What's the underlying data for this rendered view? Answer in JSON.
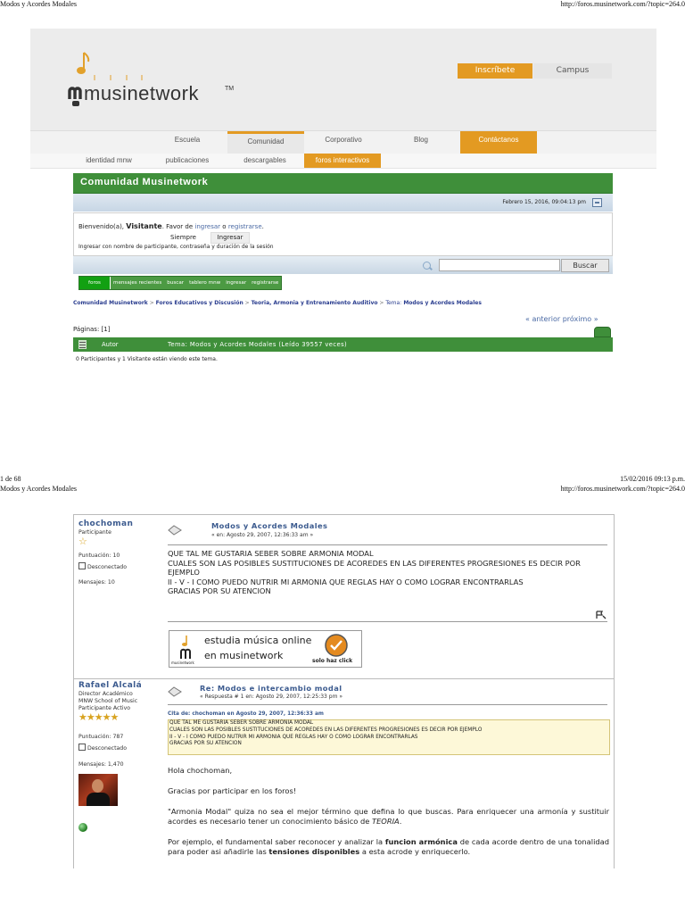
{
  "print": {
    "title": "Modos y Acordes Modales",
    "url": "http://foros.musinetwork.com/?topic=264.0",
    "page_no": "1 de 68",
    "datetime": "15/02/2016 09:13 p.m."
  },
  "header": {
    "logo": "musinetwork",
    "tm": "TM",
    "btn_inscribete": "Inscríbete",
    "btn_campus": "Campus",
    "nav1": [
      "Escuela",
      "Comunidad",
      "Corporativo",
      "Blog",
      "Contáctanos"
    ],
    "nav2": [
      "identidad mnw",
      "publicaciones",
      "descargables",
      "foros interactivos"
    ]
  },
  "forum": {
    "title": "Comunidad Musinetwork",
    "date": "Febrero 15, 2016, 09:04:13 pm",
    "welcome_prefix": "Bienvenido(a),",
    "visitor": "Visitante",
    "welcome_mid": ". Favor de",
    "login_link": "ingresar",
    "or": "o",
    "register_link": "registrarse",
    "duration_value": "Siempre",
    "login_button": "Ingresar",
    "login_hint": "Ingresar con nombre de participante, contraseña y duración de la sesión",
    "search_button": "Buscar",
    "tabs": [
      "foros",
      "mensajes recientes",
      "buscar",
      "tablero mnw",
      "ingresar",
      "registrarse"
    ],
    "breadcrumb": [
      "Comunidad Musinetwork",
      "Foros Educativos y Discusión",
      "Teoria, Armonia y Entrenamiento Auditivo"
    ],
    "breadcrumb_topic_label": "Tema:",
    "breadcrumb_topic": "Modos y Acordes Modales",
    "pager_nav": "« anterior próximo »",
    "pages_label": "Páginas: [1]",
    "col_author": "Autor",
    "col_topic": "Tema: Modos y Acordes Modales  (Leído 39557 veces)",
    "viewers": "0 Participantes y 1 Visitante están viendo este tema."
  },
  "posts": [
    {
      "author": "chochoman",
      "role": "Participante",
      "score": "Puntuación: 10",
      "status": "Desconectado",
      "messages": "Mensajes: 10",
      "title": "Modos y Acordes Modales",
      "sub": "« en: Agosto 29, 2007, 12:36:33 am »",
      "body": [
        "QUE TAL ME GUSTARIA SEBER SOBRE ARMONIA MODAL",
        "CUALES SON LAS POSIBLES SUSTITUCIONES DE ACOREDES EN LAS DIFERENTES PROGRESIONES ES DECIR POR EJEMPLO",
        "II - V - I  COMO PUEDO NUTRIR MI ARMONIA  QUE REGLAS HAY O COMO LOGRAR ENCONTRARLAS",
        "GRACIAS POR SU ATENCION"
      ],
      "ad_line1": "estudia música online",
      "ad_line2": "en musinetwork",
      "ad_brand": "musinetwork",
      "ad_cta": "solo haz click"
    },
    {
      "author": "Rafael Alcalá",
      "role_lines": [
        "Director Académico",
        "MNW School of Music",
        "Participante Activo"
      ],
      "score": "Puntuación: 787",
      "status": "Desconectado",
      "messages": "Mensajes: 1,470",
      "title": "Re: Modos e intercambio modal",
      "sub": "« Respuesta # 1 en: Agosto 29, 2007, 12:25:33 pm »",
      "quote_header": "Cita de: chochoman en Agosto 29, 2007, 12:36:33 am",
      "quote": [
        "QUE TAL ME GUSTARIA SEBER SOBRE ARMONIA MODAL",
        "CUALES SON LAS POSIBLES SUSTITUCIONES DE ACOREDES EN LAS DIFERENTES PROGRESIONES ES DECIR POR EJEMPLO",
        "II - V - I  COMO PUEDO NUTRIR MI ARMONIA  QUE REGLAS HAY O COMO LOGRAR ENCONTRARLAS",
        "GRACIAS POR SU ATENCION"
      ],
      "p1": "Hola chochoman,",
      "p2": "Gracias por participar en los foros!",
      "p3a": "\"Armonia Modal\" quiza no sea el mejor término que defina lo que buscas. Para enriquecer una armonía y sustituir acordes es necesario tener un conocimiento básico de",
      "p3b": "TEORIA",
      "p3c": ".",
      "p4a": "Por ejemplo, el fundamental saber reconocer y analizar la",
      "p4b": "funcion armónica",
      "p4c": "de cada acorde dentro de una tonalidad para poder asi añadirle las",
      "p4d": "tensiones disponibles",
      "p4e": "a esta acrode y enriquecerlo."
    }
  ]
}
